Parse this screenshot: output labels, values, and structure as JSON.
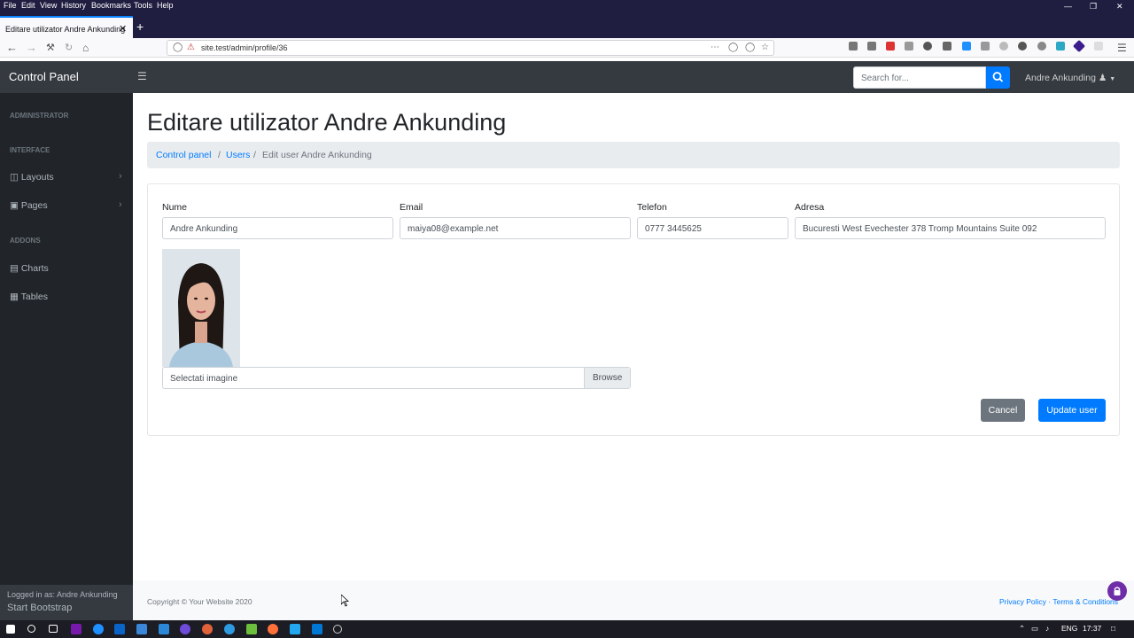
{
  "browser": {
    "menu": [
      "File",
      "Edit",
      "View",
      "History",
      "Bookmarks",
      "Tools",
      "Help"
    ],
    "tab_title": "Editare utilizator Andre Ankunding",
    "url": "site.test/admin/profile/36"
  },
  "app": {
    "brand": "Control Panel",
    "search_placeholder": "Search for...",
    "user_menu": "Andre Ankunding",
    "sidebar": {
      "section_admin": "ADMINISTRATOR",
      "section_interface": "INTERFACE",
      "layouts": "Layouts",
      "pages": "Pages",
      "section_addons": "ADDONS",
      "charts": "Charts",
      "tables": "Tables",
      "logged_in": "Logged in as: Andre Ankunding",
      "footer_brand": "Start Bootstrap"
    },
    "page_title": "Editare utilizator Andre Ankunding",
    "breadcrumb": {
      "home": "Control panel",
      "users": "Users",
      "current": "Edit user Andre Ankunding"
    },
    "form": {
      "name_label": "Nume",
      "name_value": "Andre Ankunding",
      "email_label": "Email",
      "email_value": "maiya08@example.net",
      "phone_label": "Telefon",
      "phone_value": "0777 3445625",
      "address_label": "Adresa",
      "address_value": "Bucuresti West Evechester 378 Tromp Mountains Suite 092",
      "file_placeholder": "Selectati imagine",
      "browse": "Browse",
      "cancel": "Cancel",
      "update": "Update user"
    },
    "footer": {
      "copyright": "Copyright © Your Website 2020",
      "privacy": "Privacy Policy",
      "dot": "·",
      "terms": "Terms & Conditions"
    }
  },
  "taskbar": {
    "lang": "ENG",
    "time": "17:37"
  }
}
